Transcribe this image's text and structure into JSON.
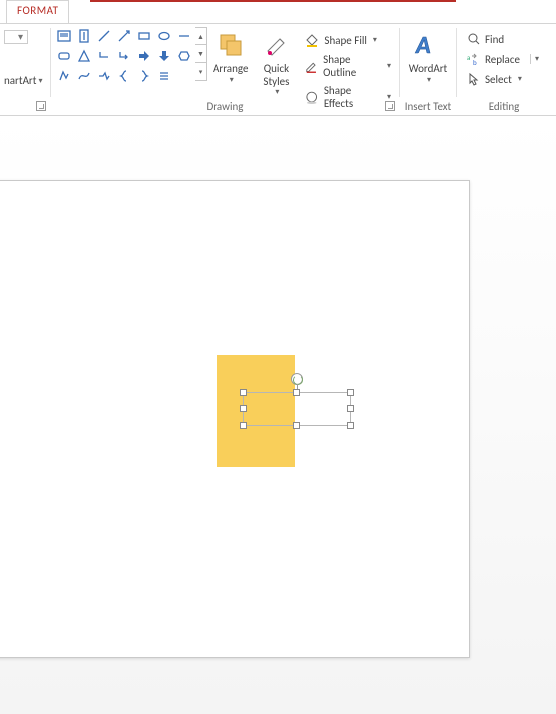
{
  "tab": {
    "format": "FORMAT"
  },
  "frag": {
    "smartart": "nartArt"
  },
  "groups": {
    "drawing": "Drawing",
    "insert_text": "Insert Text",
    "editing": "Editing"
  },
  "drawing": {
    "arrange": "Arrange",
    "quick_styles": "Quick\nStyles",
    "shape_fill": "Shape Fill",
    "shape_outline": "Shape Outline",
    "shape_effects": "Shape Effects"
  },
  "insert_text": {
    "wordart": "WordArt"
  },
  "editing": {
    "find": "Find",
    "replace": "Replace",
    "select": "Select"
  },
  "canvas": {
    "yellow_shape": {
      "present": true
    },
    "textbox": {
      "selected": true,
      "text": ""
    }
  }
}
